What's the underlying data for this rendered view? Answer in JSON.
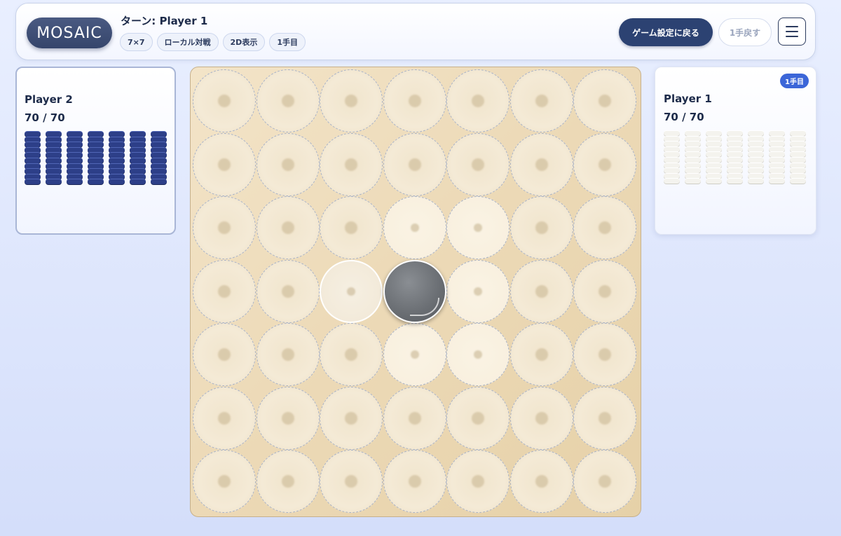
{
  "header": {
    "logo_text": "MOSAIC",
    "turn_label": "ターン: Player 1",
    "chips": [
      "7×7",
      "ローカル対戦",
      "2D表示",
      "1手目"
    ],
    "back_button": "ゲーム設定に戻る",
    "undo_button": "1手戻す"
  },
  "players": {
    "left": {
      "name": "Player 2",
      "count": "70 / 70",
      "stack_color": "#2d3f88",
      "stacks": 7,
      "discs_per_stack": 10
    },
    "right": {
      "name": "Player 1",
      "count": "70 / 70",
      "badge": "1手目",
      "stack_color": "#f4f3ee",
      "stacks": 7,
      "discs_per_stack": 10
    }
  },
  "board": {
    "size": 7,
    "placed": [
      {
        "row": 3,
        "col": 3,
        "color": "gray"
      }
    ],
    "hover": {
      "row": 3,
      "col": 2
    }
  }
}
